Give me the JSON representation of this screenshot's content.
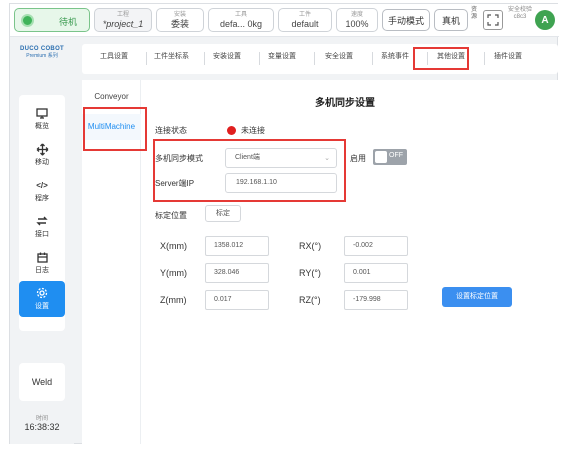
{
  "topbar": {
    "status_text": "待机",
    "project": {
      "label": "工程",
      "value": "*project_1"
    },
    "install": {
      "label": "安装",
      "value": "委装"
    },
    "tool": {
      "label": "工具",
      "value": "defa... 0kg"
    },
    "workpiece": {
      "label": "工件",
      "value": "default"
    },
    "speed": {
      "label": "速度",
      "value": "100%"
    },
    "manual_mode": "手动模式",
    "real_machine": "真机",
    "vertical_text": "资源",
    "safety_text": "安全校验 c8c3",
    "avatar": "A"
  },
  "leftnav": {
    "logo_line1": "DUCO COBOT",
    "logo_line2": "Premium 系列",
    "items": [
      {
        "label": "概览",
        "icon": "monitor-icon"
      },
      {
        "label": "移动",
        "icon": "move-arrows-icon"
      },
      {
        "label": "程序",
        "icon": "code-icon"
      },
      {
        "label": "接口",
        "icon": "interface-arrows-icon"
      },
      {
        "label": "日志",
        "icon": "calendar-icon"
      },
      {
        "label": "设置",
        "icon": "gear-icon"
      }
    ],
    "weld": "Weld",
    "clock_label": "时间",
    "clock_value": "16:38:32"
  },
  "tabs": [
    {
      "label": "工具设置"
    },
    {
      "label": "工件坐标系"
    },
    {
      "label": "安装设置"
    },
    {
      "label": "变量设置"
    },
    {
      "label": "安全设置"
    },
    {
      "label": "系统事件"
    },
    {
      "label": "其他设置"
    },
    {
      "label": "插件设置"
    }
  ],
  "subnav": [
    {
      "label": "Conveyor"
    },
    {
      "label": "MultiMachine"
    }
  ],
  "panel": {
    "title": "多机同步设置",
    "connection_label": "连接状态",
    "connection_value": "未连接",
    "mode_label": "多机同步模式",
    "mode_value": "Client端",
    "enable_label": "启用",
    "toggle_text": "OFF",
    "ip_label": "Server端IP",
    "ip_value": "192.168.1.10",
    "calib_label": "标定位置",
    "calib_button": "标定",
    "x_label": "X(mm)",
    "x_value": "1358.012",
    "y_label": "Y(mm)",
    "y_value": "328.046",
    "z_label": "Z(mm)",
    "z_value": "0.017",
    "rx_label": "RX(°)",
    "rx_value": "-0.002",
    "ry_label": "RY(°)",
    "ry_value": "0.001",
    "rz_label": "RZ(°)",
    "rz_value": "-179.998",
    "set_button": "设置标定位置"
  },
  "colors": {
    "accent": "#1f8ef1",
    "highlight": "#e53935",
    "status_green": "#3fb45a"
  }
}
